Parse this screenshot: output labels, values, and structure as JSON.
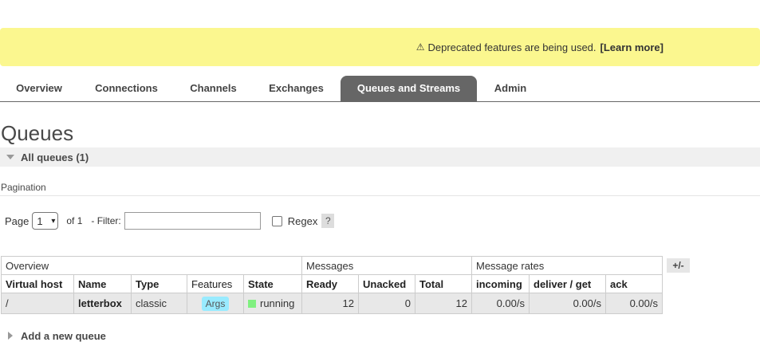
{
  "banner": {
    "icon": "warning-icon",
    "icon_glyph": "⚠",
    "message": "Deprecated features are being used.",
    "link": "[Learn more]"
  },
  "tabs": [
    {
      "label": "Overview",
      "active": false
    },
    {
      "label": "Connections",
      "active": false
    },
    {
      "label": "Channels",
      "active": false
    },
    {
      "label": "Exchanges",
      "active": false
    },
    {
      "label": "Queues and Streams",
      "active": true
    },
    {
      "label": "Admin",
      "active": false
    }
  ],
  "page": {
    "title": "Queues",
    "section_title": "All queues (1)",
    "pagination_label": "Pagination"
  },
  "pager": {
    "page_label": "Page",
    "page_value": "1",
    "of_text": "of 1",
    "filter_label": "- Filter:",
    "filter_value": "",
    "regex_label": "Regex",
    "help": "?"
  },
  "table": {
    "groups": [
      "Overview",
      "Messages",
      "Message rates"
    ],
    "columns": [
      "Virtual host",
      "Name",
      "Type",
      "Features",
      "State",
      "Ready",
      "Unacked",
      "Total",
      "incoming",
      "deliver / get",
      "ack"
    ],
    "rows": [
      {
        "virtual_host": "/",
        "name": "letterbox",
        "type": "classic",
        "features": "Args",
        "state": "running",
        "ready": "12",
        "unacked": "0",
        "total": "12",
        "incoming": "0.00/s",
        "deliver_get": "0.00/s",
        "ack": "0.00/s"
      }
    ],
    "toggle": "+/-"
  },
  "add_queue": {
    "label": "Add a new queue"
  },
  "colors": {
    "banner": "#fbf78f",
    "active_tab": "#666666",
    "args_badge": "#99ebff",
    "running": "#80f080"
  }
}
